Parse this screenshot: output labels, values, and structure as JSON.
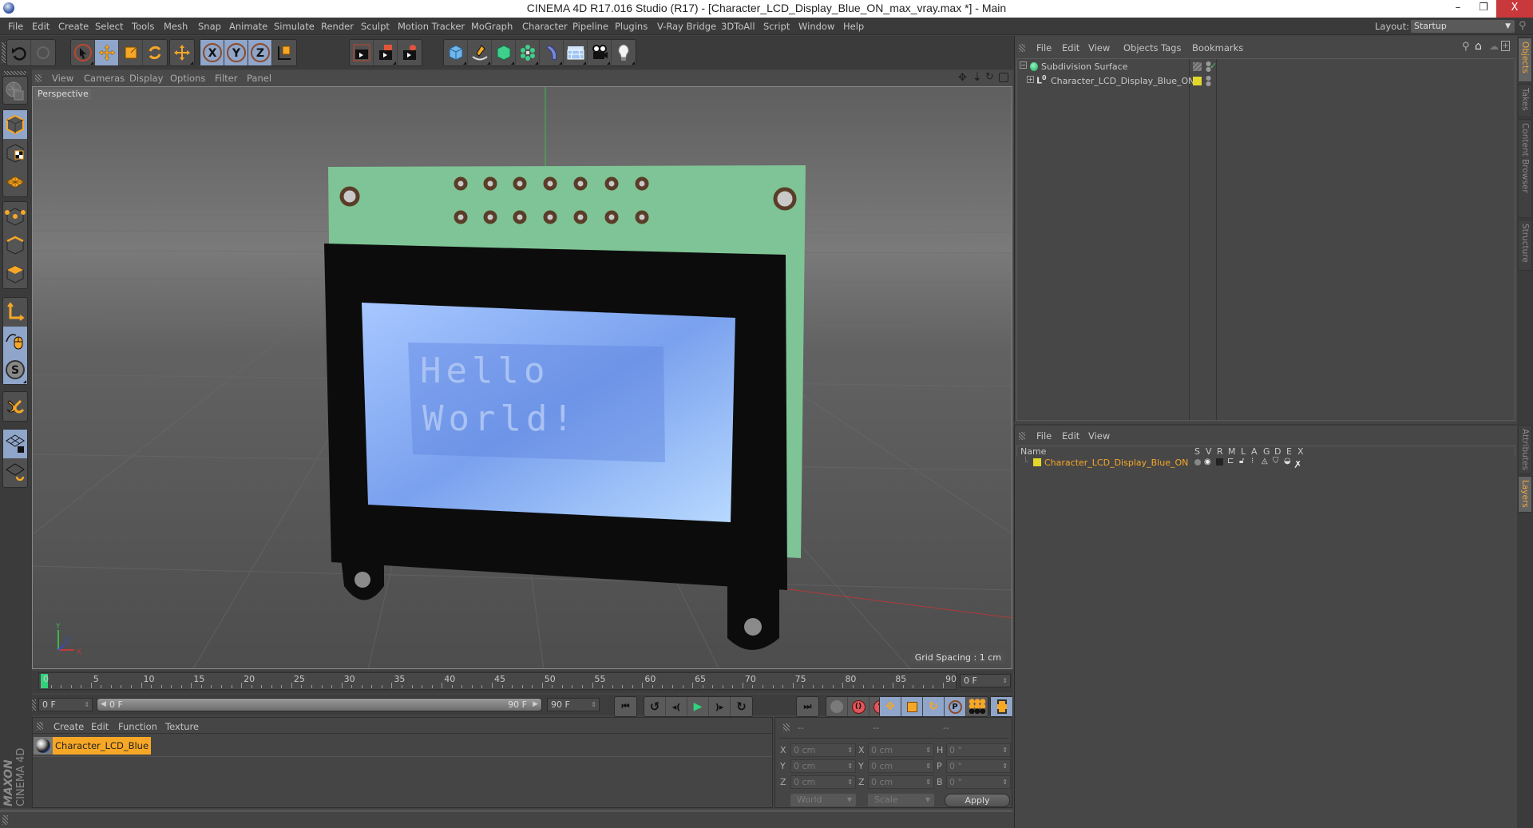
{
  "window": {
    "title": "CINEMA 4D R17.016 Studio (R17) - [Character_LCD_Display_Blue_ON_max_vray.max *] - Main",
    "controls": {
      "minimize": "–",
      "restore": "❐",
      "close": "X"
    }
  },
  "menubar": {
    "items": [
      "File",
      "Edit",
      "Create",
      "Select",
      "Tools",
      "Mesh",
      "Snap",
      "Animate",
      "Simulate",
      "Render",
      "Sculpt",
      "Motion Tracker",
      "MoGraph",
      "Character",
      "Pipeline",
      "Plugins",
      "V-Ray Bridge",
      "3DToAll",
      "Script",
      "Window",
      "Help"
    ],
    "layout_label": "Layout:",
    "layout_value": "Startup"
  },
  "toolbar": {
    "groups": [
      {
        "tools": [
          {
            "name": "undo-icon",
            "on": false
          },
          {
            "name": "redo-icon",
            "on": false
          }
        ]
      },
      {
        "tools": [
          {
            "name": "select-icon",
            "on": false
          },
          {
            "name": "move-icon",
            "on": true
          },
          {
            "name": "scale-icon",
            "on": false
          },
          {
            "name": "rotate-icon",
            "on": false
          }
        ]
      },
      {
        "tools": [
          {
            "name": "last-tool-icon",
            "on": false
          }
        ]
      },
      {
        "tools": [
          {
            "name": "x-axis-icon",
            "on": true,
            "label": "X"
          },
          {
            "name": "y-axis-icon",
            "on": true,
            "label": "Y"
          },
          {
            "name": "z-axis-icon",
            "on": true,
            "label": "Z"
          },
          {
            "name": "coordinate-system-icon",
            "on": false
          }
        ]
      },
      {
        "tools": [
          {
            "name": "render-view-icon",
            "on": false
          },
          {
            "name": "render-picture-viewer-icon",
            "on": false
          },
          {
            "name": "render-settings-icon",
            "on": false
          }
        ]
      },
      {
        "tools": [
          {
            "name": "cube-icon",
            "on": false
          },
          {
            "name": "pen-spline-icon",
            "on": false
          },
          {
            "name": "subdivision-icon",
            "on": false
          },
          {
            "name": "cloner-icon",
            "on": false
          },
          {
            "name": "deformer-icon",
            "on": false
          },
          {
            "name": "floor-icon",
            "on": false
          },
          {
            "name": "camera-icon",
            "on": false
          },
          {
            "name": "light-icon",
            "on": false
          }
        ]
      }
    ]
  },
  "left_toolbar": {
    "tools": [
      "make-editable-icon",
      "model-mode-icon",
      "texture-mode-icon",
      "workplane-mode-icon",
      "points-mode-icon",
      "edges-mode-icon",
      "polygons-mode-icon",
      "axis-mode-icon",
      "tweak-mode-icon",
      "solo-icon",
      "snap-icon",
      "workplane-lock-icon",
      "workplane-align-icon"
    ]
  },
  "viewport": {
    "menu": [
      "View",
      "Cameras",
      "Display",
      "Options",
      "Filter",
      "Panel"
    ],
    "camera_label": "Perspective",
    "grid_spacing": "Grid Spacing : 1 cm",
    "lcd_text_line1": "Hello",
    "lcd_text_line2": "World!",
    "axis_labels": {
      "x": "X",
      "y": "Y",
      "z": "Z"
    },
    "nav_icons": [
      "pan-icon",
      "dolly-icon",
      "orbit-icon",
      "maximize-view-icon"
    ]
  },
  "timeline": {
    "tick_labels": [
      "0",
      "5",
      "10",
      "15",
      "20",
      "25",
      "30",
      "35",
      "40",
      "45",
      "50",
      "55",
      "60",
      "65",
      "70",
      "75",
      "80",
      "85",
      "90"
    ],
    "current_frame": "0 F",
    "start_field": "0 F",
    "range_start": "0 F",
    "range_end": "90 F",
    "end_field": "90 F",
    "playhead_fraction": 0
  },
  "material_manager": {
    "menu": [
      "Create",
      "Edit",
      "Function",
      "Texture"
    ],
    "materials": [
      {
        "name": "Character_LCD_Blue",
        "selected": true
      }
    ],
    "logo_brand": "MAXON",
    "logo_product": "CINEMA 4D"
  },
  "coordinates": {
    "headers": [
      "--",
      "--",
      "--"
    ],
    "rows": [
      {
        "pos_label": "X",
        "pos": "0 cm",
        "size_label": "X",
        "size": "0 cm",
        "rot_label": "H",
        "rot": "0 °"
      },
      {
        "pos_label": "Y",
        "pos": "0 cm",
        "size_label": "Y",
        "size": "0 cm",
        "rot_label": "P",
        "rot": "0 °"
      },
      {
        "pos_label": "Z",
        "pos": "0 cm",
        "size_label": "Z",
        "size": "0 cm",
        "rot_label": "B",
        "rot": "0 °"
      }
    ],
    "coord_system": "World",
    "size_mode": "Scale",
    "apply_label": "Apply"
  },
  "object_manager": {
    "menu": [
      "File",
      "Edit",
      "View",
      "Objects",
      "Tags",
      "Bookmarks"
    ],
    "objects": [
      {
        "name": "Subdivision Surface",
        "expanded": true,
        "enabled_check": "✓"
      },
      {
        "name": "Character_LCD_Display_Blue_ON",
        "expanded": false,
        "layer_color": "#e2d82a"
      }
    ]
  },
  "layer_manager": {
    "menu": [
      "File",
      "Edit",
      "View"
    ],
    "columns": [
      "Name",
      "S",
      "V",
      "R",
      "M",
      "L",
      "A",
      "G",
      "D",
      "E",
      "X"
    ],
    "layers": [
      {
        "name": "Character_LCD_Display_Blue_ON",
        "color": "#e2d82a"
      }
    ]
  },
  "right_tabs": {
    "top": [
      {
        "label": "Objects",
        "active": true
      },
      {
        "label": "Takes",
        "active": false
      },
      {
        "label": "Content Browser",
        "active": false
      },
      {
        "label": "Structure",
        "active": false
      }
    ],
    "bottom": [
      {
        "label": "Attributes",
        "active": false
      },
      {
        "label": "Layers",
        "active": true
      }
    ]
  },
  "colors": {
    "accent_orange": "#f7a726",
    "selected_blue": "#8fa5c9",
    "layer_yellow": "#e2d82a",
    "pcb_green": "#7fc496",
    "lcd_blue": "#7fa7f0"
  }
}
